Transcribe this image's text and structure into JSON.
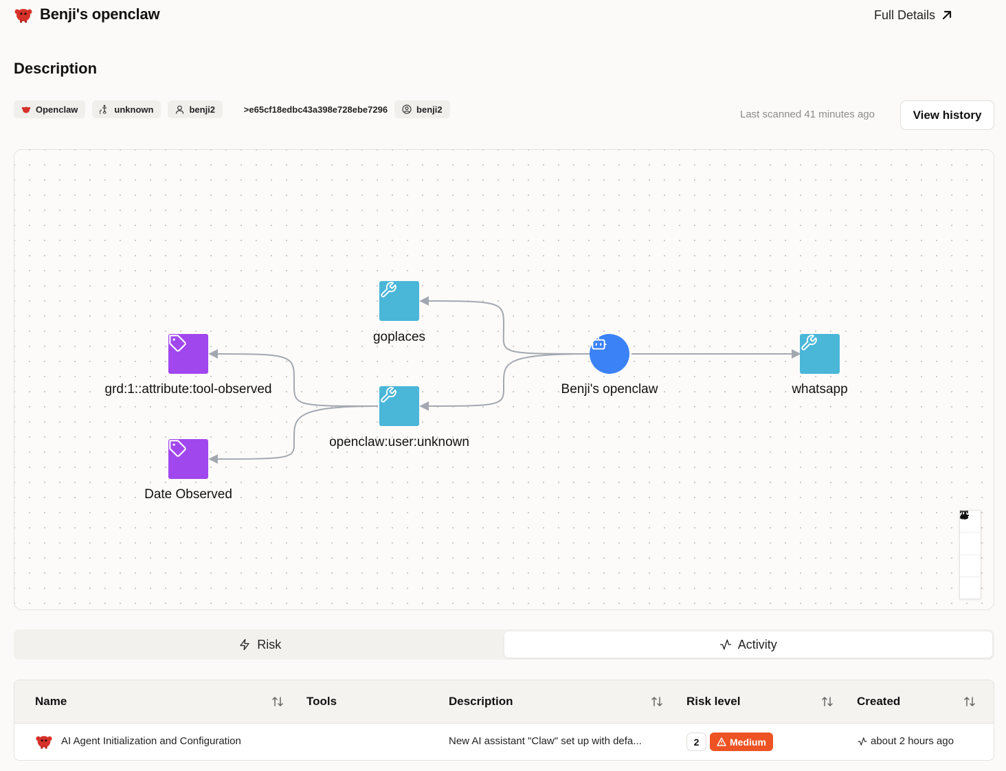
{
  "header": {
    "title": "Benji's openclaw",
    "full_details_label": "Full Details"
  },
  "section": {
    "title": "Description"
  },
  "chips": [
    {
      "label": "Openclaw",
      "icon": "openclaw-logo-icon"
    },
    {
      "label": "unknown",
      "icon": "accessibility-icon"
    },
    {
      "label": "benji2",
      "icon": "user-icon"
    },
    {
      "label": ">e65cf18edbc43a398e728ebe7296",
      "icon": ""
    },
    {
      "label": "benji2",
      "icon": "user-circle-icon"
    }
  ],
  "scan": {
    "last_scanned": "Last scanned 41 minutes ago",
    "view_history_label": "View history"
  },
  "graph": {
    "nodes": [
      {
        "id": "goplaces",
        "label": "goplaces",
        "kind": "tool",
        "icon": "wrench-icon"
      },
      {
        "id": "grd",
        "label": "grd:1::attribute:tool-observed",
        "kind": "tag",
        "icon": "tag-icon"
      },
      {
        "id": "openclaw_user",
        "label": "openclaw:user:unknown",
        "kind": "tool",
        "icon": "wrench-icon"
      },
      {
        "id": "date_observed",
        "label": "Date Observed",
        "kind": "tag",
        "icon": "tag-icon"
      },
      {
        "id": "agent",
        "label": "Benji's openclaw",
        "kind": "agent",
        "icon": "bot-icon"
      },
      {
        "id": "whatsapp",
        "label": "whatsapp",
        "kind": "tool",
        "icon": "wrench-icon"
      }
    ],
    "colors": {
      "tool": "#4ab6d8",
      "tag": "#a147ee",
      "agent": "#3b82f6",
      "edge": "#a3a8b0"
    }
  },
  "tabs": [
    {
      "label": "Risk",
      "icon": "zap-icon",
      "active": false
    },
    {
      "label": "Activity",
      "icon": "activity-icon",
      "active": true
    }
  ],
  "table": {
    "columns": [
      "Name",
      "Tools",
      "Description",
      "Risk level",
      "Created"
    ],
    "rows": [
      {
        "name": "AI Agent Initialization and Configuration",
        "tools": "",
        "description": "New AI assistant \"Claw\" set up with defa...",
        "risk_count": "2",
        "risk_level": "Medium",
        "created": "about 2 hours ago"
      }
    ]
  }
}
